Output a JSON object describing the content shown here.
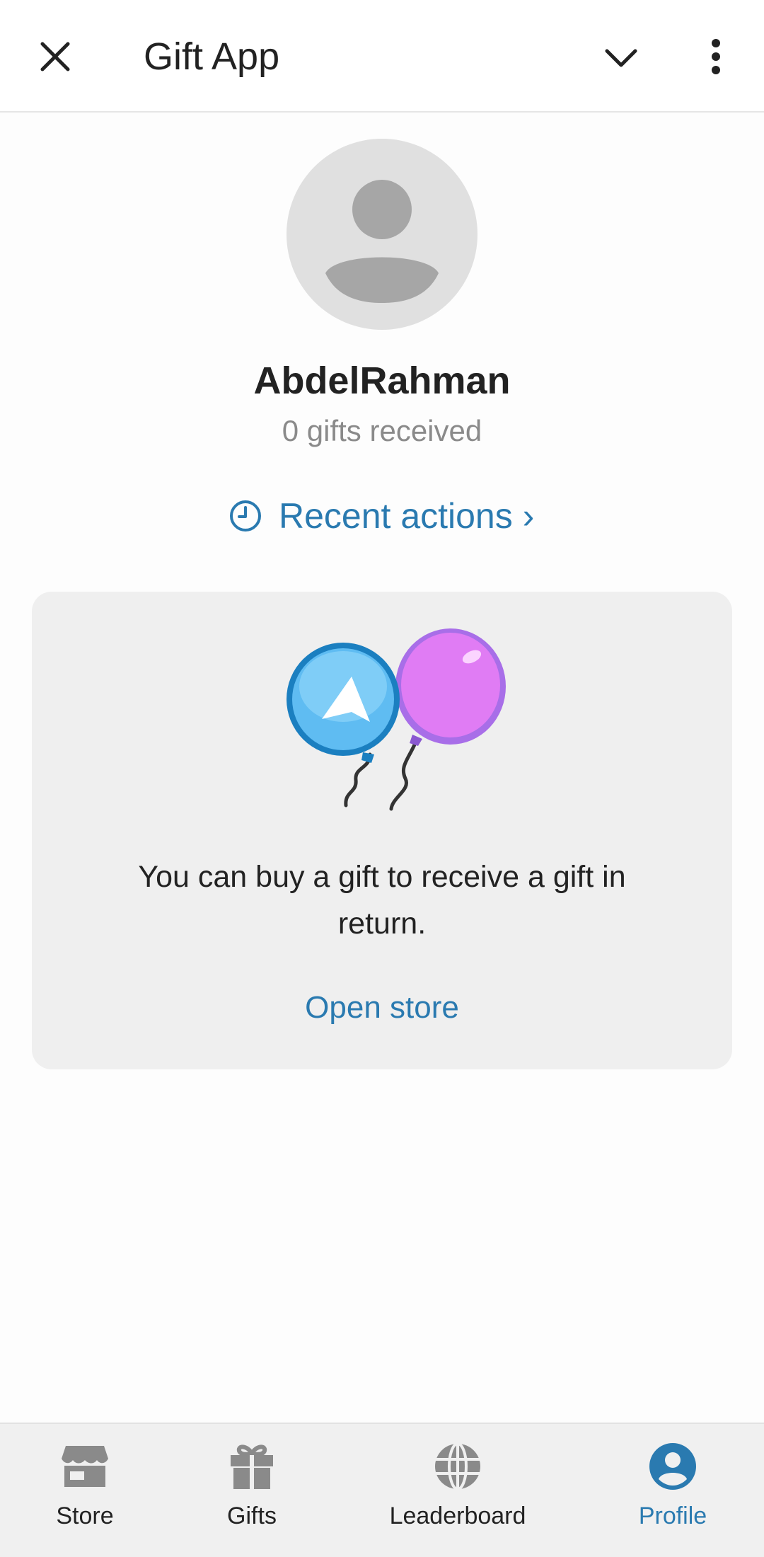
{
  "header": {
    "title": "Gift App",
    "close_icon": "close-icon",
    "chevron_icon": "chevron-down-icon",
    "more_icon": "more-vertical-icon"
  },
  "profile": {
    "avatar_icon": "person-placeholder-icon",
    "name": "AbdelRahman",
    "gifts_received": "0 gifts received",
    "recent_actions_label": "Recent actions ›",
    "recent_actions_icon": "clock-icon"
  },
  "empty_card": {
    "illustration": "balloons-illustration",
    "message": "You can buy a gift to receive a gift in return.",
    "open_store_label": "Open store"
  },
  "bottom_nav": {
    "items": [
      {
        "label": "Store",
        "icon": "store-icon",
        "active": false
      },
      {
        "label": "Gifts",
        "icon": "gift-icon",
        "active": false
      },
      {
        "label": "Leaderboard",
        "icon": "globe-icon",
        "active": false
      },
      {
        "label": "Profile",
        "icon": "profile-icon",
        "active": true
      }
    ]
  },
  "colors": {
    "accent": "#2a7ab0",
    "muted_text": "#8a8a8a",
    "card_background": "#efefef",
    "nav_background": "#f0f0f0",
    "icon_gray": "#8a8a8a"
  }
}
